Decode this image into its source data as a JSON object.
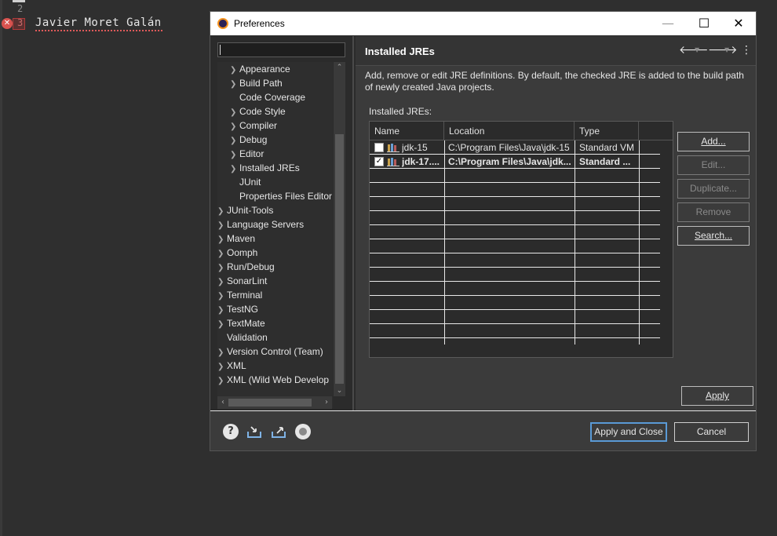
{
  "editor": {
    "line_numbers": [
      "2",
      "3"
    ],
    "code_line": "Javier Moret Galán"
  },
  "dialog": {
    "title": "Preferences",
    "window_controls": {
      "minimize": "—",
      "maximize": "☐",
      "close": "✕"
    },
    "filter_value": "",
    "tree": [
      {
        "label": "Appearance",
        "expandable": true,
        "level": 1
      },
      {
        "label": "Build Path",
        "expandable": true,
        "level": 1
      },
      {
        "label": "Code Coverage",
        "expandable": false,
        "level": 1
      },
      {
        "label": "Code Style",
        "expandable": true,
        "level": 1
      },
      {
        "label": "Compiler",
        "expandable": true,
        "level": 1
      },
      {
        "label": "Debug",
        "expandable": true,
        "level": 1
      },
      {
        "label": "Editor",
        "expandable": true,
        "level": 1
      },
      {
        "label": "Installed JREs",
        "expandable": true,
        "level": 1
      },
      {
        "label": "JUnit",
        "expandable": false,
        "level": 1
      },
      {
        "label": "Properties Files Editor",
        "expandable": false,
        "level": 1
      },
      {
        "label": "JUnit-Tools",
        "expandable": true,
        "level": 0
      },
      {
        "label": "Language Servers",
        "expandable": true,
        "level": 0
      },
      {
        "label": "Maven",
        "expandable": true,
        "level": 0
      },
      {
        "label": "Oomph",
        "expandable": true,
        "level": 0
      },
      {
        "label": "Run/Debug",
        "expandable": true,
        "level": 0
      },
      {
        "label": "SonarLint",
        "expandable": true,
        "level": 0
      },
      {
        "label": "Terminal",
        "expandable": true,
        "level": 0
      },
      {
        "label": "TestNG",
        "expandable": true,
        "level": 0
      },
      {
        "label": "TextMate",
        "expandable": true,
        "level": 0
      },
      {
        "label": "Validation",
        "expandable": false,
        "level": 0
      },
      {
        "label": "Version Control (Team)",
        "expandable": true,
        "level": 0
      },
      {
        "label": "XML",
        "expandable": true,
        "level": 0
      },
      {
        "label": "XML (Wild Web Develop",
        "expandable": true,
        "level": 0
      }
    ],
    "page": {
      "title": "Installed JREs",
      "description": "Add, remove or edit JRE definitions. By default, the checked JRE is added to the build path of newly created Java projects.",
      "table_label": "Installed JREs:",
      "columns": [
        "Name",
        "Location",
        "Type"
      ],
      "rows": [
        {
          "checked": false,
          "name": "jdk-15",
          "location": "C:\\Program Files\\Java\\jdk-15",
          "type": "Standard VM",
          "bold": false
        },
        {
          "checked": true,
          "name": "jdk-17....",
          "location": "C:\\Program Files\\Java\\jdk...",
          "type": "Standard ...",
          "bold": true
        }
      ],
      "buttons": {
        "add": "Add...",
        "edit": "Edit...",
        "duplicate": "Duplicate...",
        "remove": "Remove",
        "search": "Search..."
      },
      "apply": "Apply"
    },
    "footer": {
      "help_glyph": "?",
      "apply_and_close": "Apply and Close",
      "cancel": "Cancel"
    }
  }
}
